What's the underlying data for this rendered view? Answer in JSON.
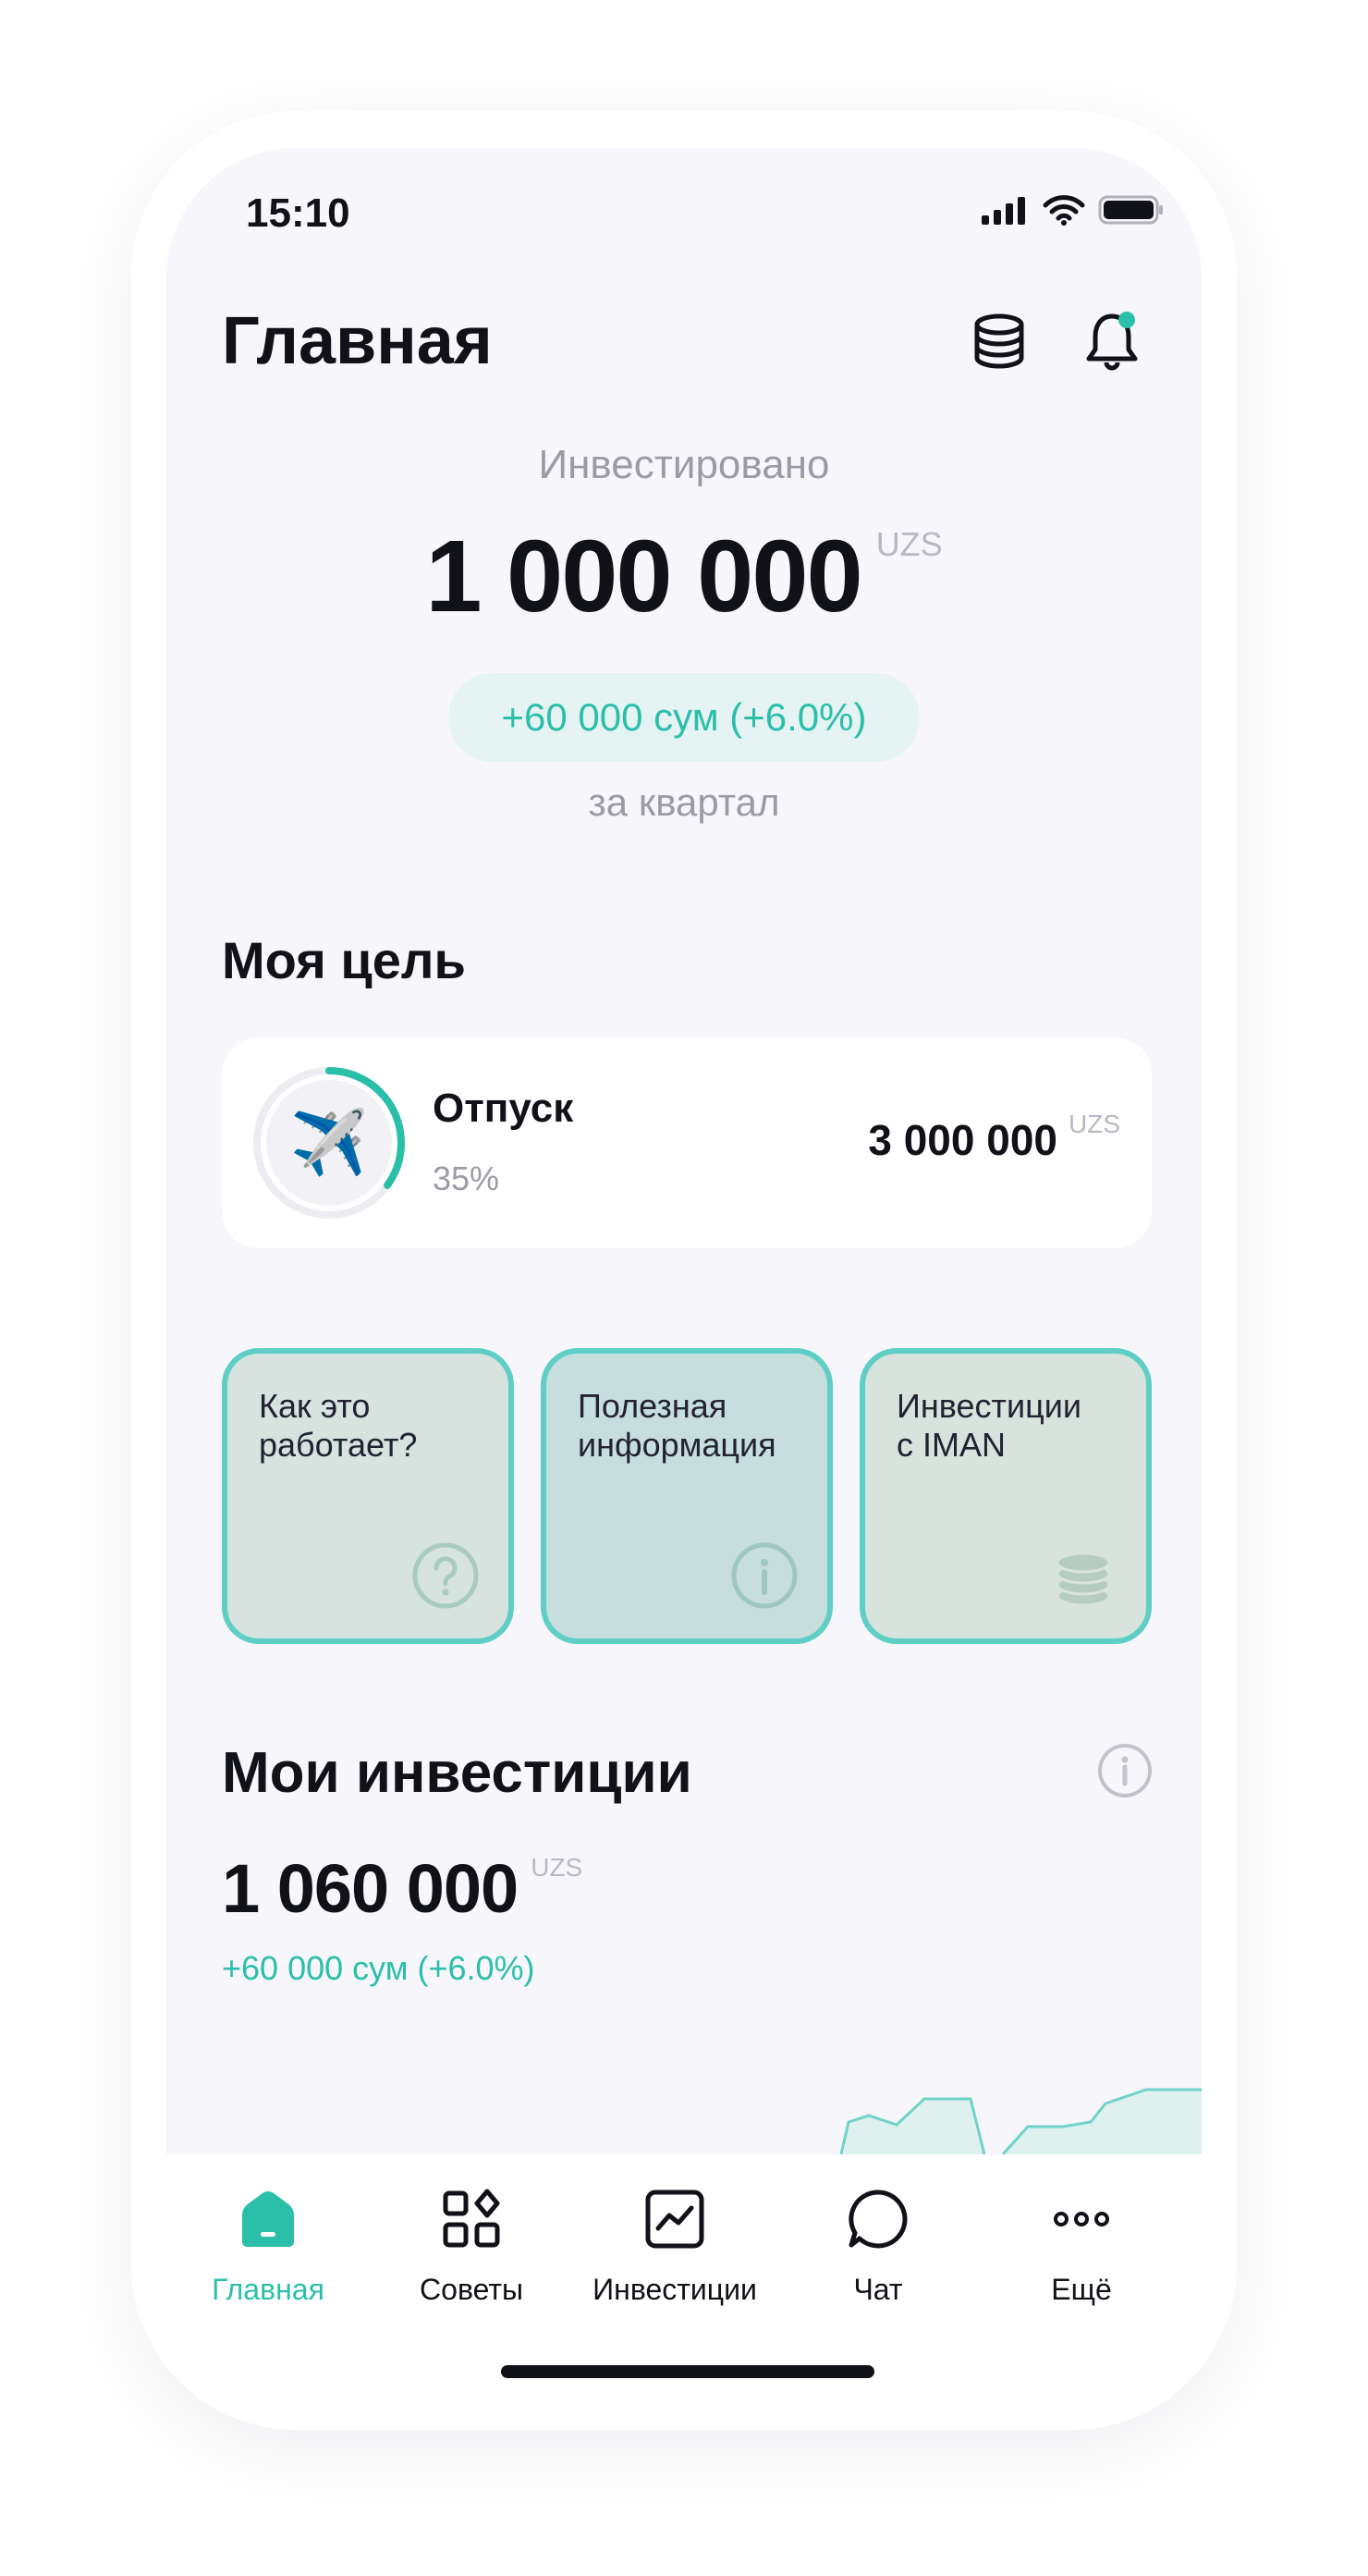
{
  "status_bar": {
    "time": "15:10"
  },
  "header": {
    "title": "Главная",
    "coins_icon": "coins-icon",
    "bell_icon": "bell-icon"
  },
  "invested": {
    "label": "Инвестировано",
    "amount": "1 000 000",
    "currency": "UZS",
    "change": "+60 000 сум (+6.0%)",
    "period": "за квартал"
  },
  "goal": {
    "section_title": "Моя цель",
    "emoji": "✈️",
    "name": "Отпуск",
    "percent_label": "35%",
    "progress": 0.35,
    "target": "3 000 000",
    "currency": "UZS"
  },
  "info_cards": [
    {
      "label": "Как это\nработает?",
      "icon": "question-icon",
      "bg": "#d6e3df"
    },
    {
      "label": "Полезная\nинформация",
      "icon": "info-icon",
      "bg": "#c7dede"
    },
    {
      "label": "Инвестиции\nс IMAN",
      "icon": "coins-stack-icon",
      "bg": "#d8e3dd"
    }
  ],
  "investments": {
    "section_title": "Мои инвестиции",
    "amount": "1 060 000",
    "currency": "UZS",
    "change": "+60 000 сум (+6.0%)"
  },
  "tabs": [
    {
      "label": "Главная",
      "icon": "home-icon",
      "active": true
    },
    {
      "label": "Советы",
      "icon": "tips-grid-icon",
      "active": false
    },
    {
      "label": "Инвестиции",
      "icon": "chart-icon",
      "active": false
    },
    {
      "label": "Чат",
      "icon": "chat-icon",
      "active": false
    },
    {
      "label": "Ещё",
      "icon": "more-icon",
      "active": false
    }
  ],
  "colors": {
    "accent": "#2bbfa9",
    "card_border": "#5fcfc6",
    "background": "#f6f6fb"
  }
}
